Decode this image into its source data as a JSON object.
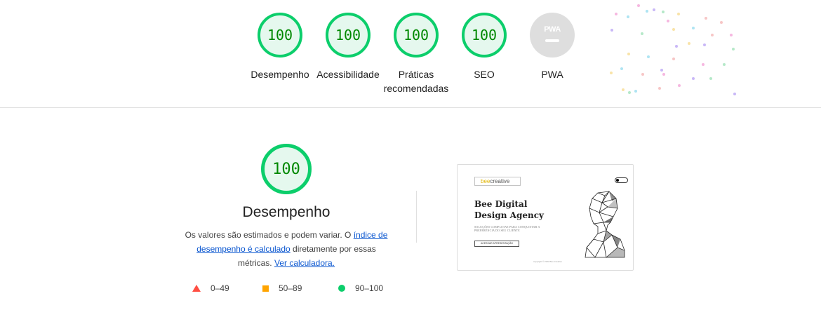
{
  "scores": [
    {
      "label": "Desempenho",
      "value": "100"
    },
    {
      "label": "Acessibilidade",
      "value": "100"
    },
    {
      "label": "Práticas recomendadas",
      "value": "100"
    },
    {
      "label": "SEO",
      "value": "100"
    }
  ],
  "pwa": {
    "label": "PWA",
    "badge_text": "PWA"
  },
  "performance": {
    "score": "100",
    "title": "Desempenho",
    "desc_before": "Os valores são estimados e podem variar. O ",
    "desc_link": "índice de desempenho é calculado",
    "desc_middle": " diretamente por essas métricas. ",
    "calc_link": "Ver calculadora."
  },
  "legend": {
    "fail": "0–49",
    "average": "50–89",
    "pass": "90–100"
  },
  "thumbnail": {
    "logo_prefix": "bee",
    "logo_suffix": "creative",
    "title": "Bee Digital Design Agency",
    "subtitle": "SOLUÇÕES COMPLETAS PARA CONQUISTAR A PREFERÊNCIA DO SEU CLIENTE",
    "button": "ACESSAR APRESENTAÇÃO",
    "footer": "copyright © 2022 Bee Creative"
  },
  "colors": {
    "pass": "#0cce6b",
    "pass_bg": "#e5f8ee",
    "pass_text": "#008800",
    "average": "#ffa400",
    "fail": "#ff4e42",
    "pwa_gray": "#dedede",
    "link": "#0b57d0"
  }
}
